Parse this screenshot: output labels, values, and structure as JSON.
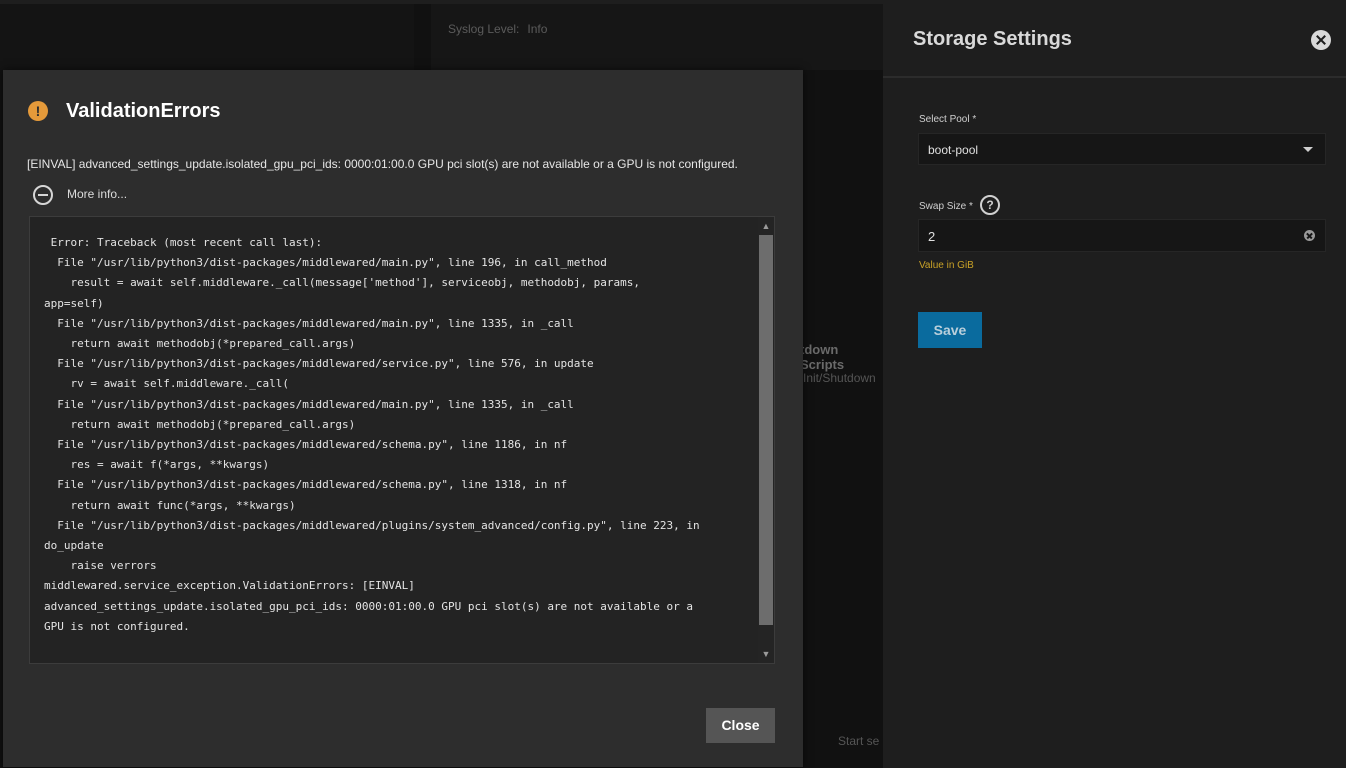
{
  "background": {
    "syslog_label": "Syslog Level:",
    "syslog_value": "Info",
    "scripts_title": "tdown Scripts",
    "scripts_sub": "Init/Shutdown",
    "start_text": "Start se"
  },
  "panel": {
    "title": "Storage Settings",
    "pool_label": "Select Pool *",
    "pool_value": "boot-pool",
    "swap_label": "Swap Size *",
    "swap_value": "2",
    "swap_hint": "Value in GiB",
    "save_label": "Save"
  },
  "dialog": {
    "title": "ValidationErrors",
    "message": "[EINVAL] advanced_settings_update.isolated_gpu_pci_ids: 0000:01:00.0 GPU pci slot(s) are not available or a GPU is not configured.",
    "more_info": "More info...",
    "close_label": "Close",
    "traceback": " Error: Traceback (most recent call last):\n  File \"/usr/lib/python3/dist-packages/middlewared/main.py\", line 196, in call_method\n    result = await self.middleware._call(message['method'], serviceobj, methodobj, params,\napp=self)\n  File \"/usr/lib/python3/dist-packages/middlewared/main.py\", line 1335, in _call\n    return await methodobj(*prepared_call.args)\n  File \"/usr/lib/python3/dist-packages/middlewared/service.py\", line 576, in update\n    rv = await self.middleware._call(\n  File \"/usr/lib/python3/dist-packages/middlewared/main.py\", line 1335, in _call\n    return await methodobj(*prepared_call.args)\n  File \"/usr/lib/python3/dist-packages/middlewared/schema.py\", line 1186, in nf\n    res = await f(*args, **kwargs)\n  File \"/usr/lib/python3/dist-packages/middlewared/schema.py\", line 1318, in nf\n    return await func(*args, **kwargs)\n  File \"/usr/lib/python3/dist-packages/middlewared/plugins/system_advanced/config.py\", line 223, in\ndo_update\n    raise verrors\nmiddlewared.service_exception.ValidationErrors: [EINVAL]\nadvanced_settings_update.isolated_gpu_pci_ids: 0000:01:00.0 GPU pci slot(s) are not available or a\nGPU is not configured."
  },
  "colors": {
    "accent": "#0a6b9e",
    "warning": "#e59a3a",
    "hint": "#c9a227"
  },
  "icons": [
    "warning-icon",
    "minus-circle-icon",
    "close-icon",
    "help-icon",
    "chevron-down-icon",
    "clear-icon"
  ]
}
